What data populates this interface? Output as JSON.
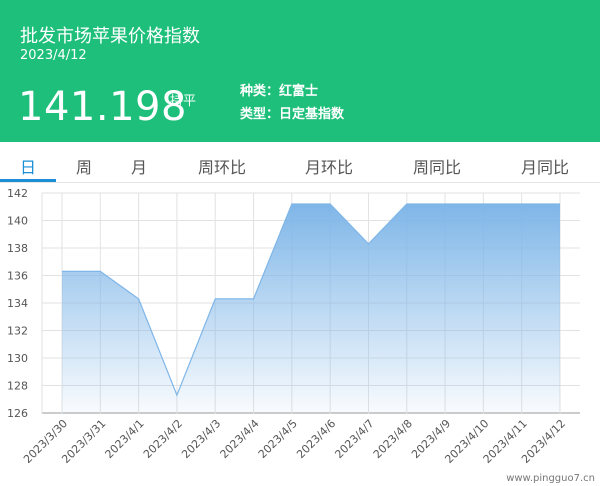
{
  "header": {
    "title": "批发市场苹果价格指数",
    "date": "2023/4/12",
    "price": "141.198",
    "trend": "持平",
    "variety": "种类：红富士",
    "kind": "类型：日定基指数"
  },
  "tabs": [
    "日",
    "周",
    "月",
    "周环比",
    "月环比",
    "周同比",
    "月同比"
  ],
  "watermark": "www.pingguo7.cn",
  "colors": {
    "header_bg": "#1dbf7a",
    "active_tab": "#1a8fd6",
    "series_line": "#7fb6e8"
  },
  "chart_data": {
    "type": "area",
    "x": [
      "2023/3/30",
      "2023/3/31",
      "2023/4/1",
      "2023/4/2",
      "2023/4/3",
      "2023/4/4",
      "2023/4/5",
      "2023/4/6",
      "2023/4/7",
      "2023/4/8",
      "2023/4/9",
      "2023/4/10",
      "2023/4/11",
      "2023/4/12"
    ],
    "values": [
      136.3,
      136.3,
      134.3,
      127.3,
      134.3,
      134.3,
      141.2,
      141.2,
      138.3,
      141.2,
      141.2,
      141.2,
      141.2,
      141.2
    ],
    "yticks": [
      126,
      128,
      130,
      132,
      134,
      136,
      138,
      140,
      142
    ],
    "ylim": [
      126,
      142
    ],
    "grid": true,
    "legend": "none"
  }
}
